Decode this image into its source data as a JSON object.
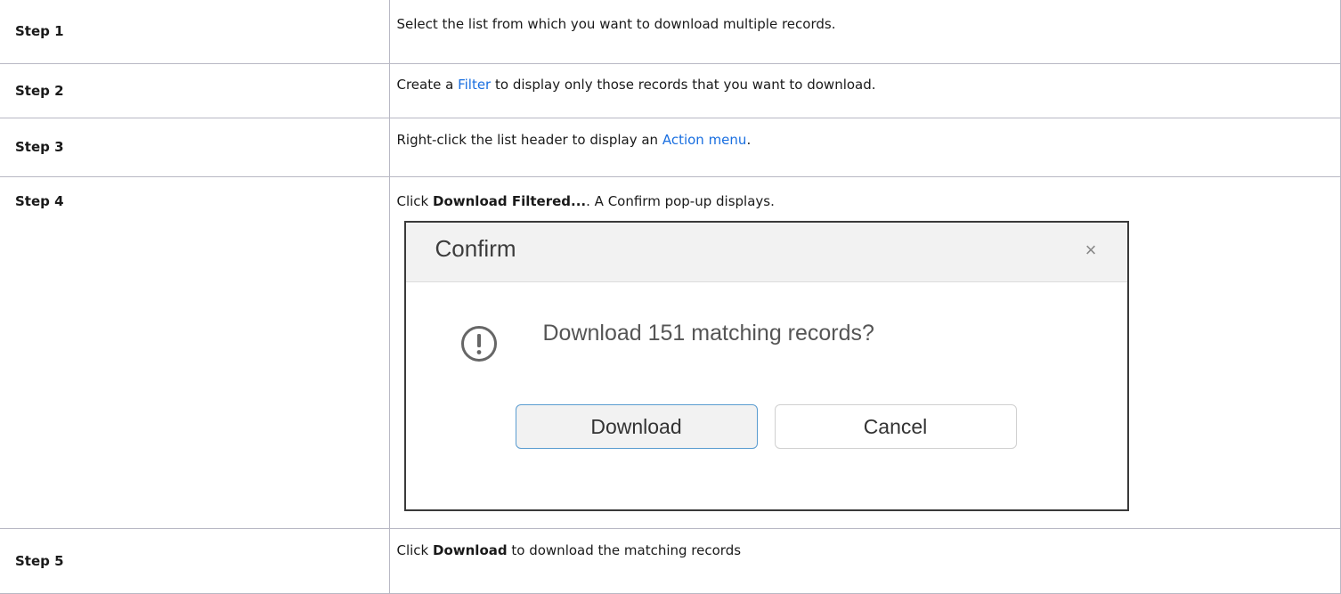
{
  "steps": [
    {
      "label": "Step 1",
      "parts": {
        "t1": "Select the list from which you want to download multiple records."
      }
    },
    {
      "label": "Step 2",
      "parts": {
        "t1": "Create a ",
        "link": "Filter",
        "t2": " to display only those records that you want to download."
      }
    },
    {
      "label": "Step 3",
      "parts": {
        "t1": "Right-click the list header to display an ",
        "link": "Action menu",
        "t2": "."
      }
    },
    {
      "label": "Step 4",
      "parts": {
        "t1": "Click ",
        "bold": "Download Filtered...",
        "t2": ". A Confirm pop-up displays."
      }
    },
    {
      "label": "Step 5",
      "parts": {
        "t1": "Click ",
        "bold": "Download",
        "t2": " to download the matching records"
      }
    }
  ],
  "dialog": {
    "title": "Confirm",
    "close_symbol": "×",
    "icon": "exclamation-circle-icon",
    "message": "Download 151 matching records?",
    "download_label": "Download",
    "cancel_label": "Cancel"
  },
  "colors": {
    "link": "#1a6fe0",
    "border": "#b8b8c4",
    "dialog_header": "#f2f2f2",
    "primary_button_border": "#5a9cd0"
  }
}
